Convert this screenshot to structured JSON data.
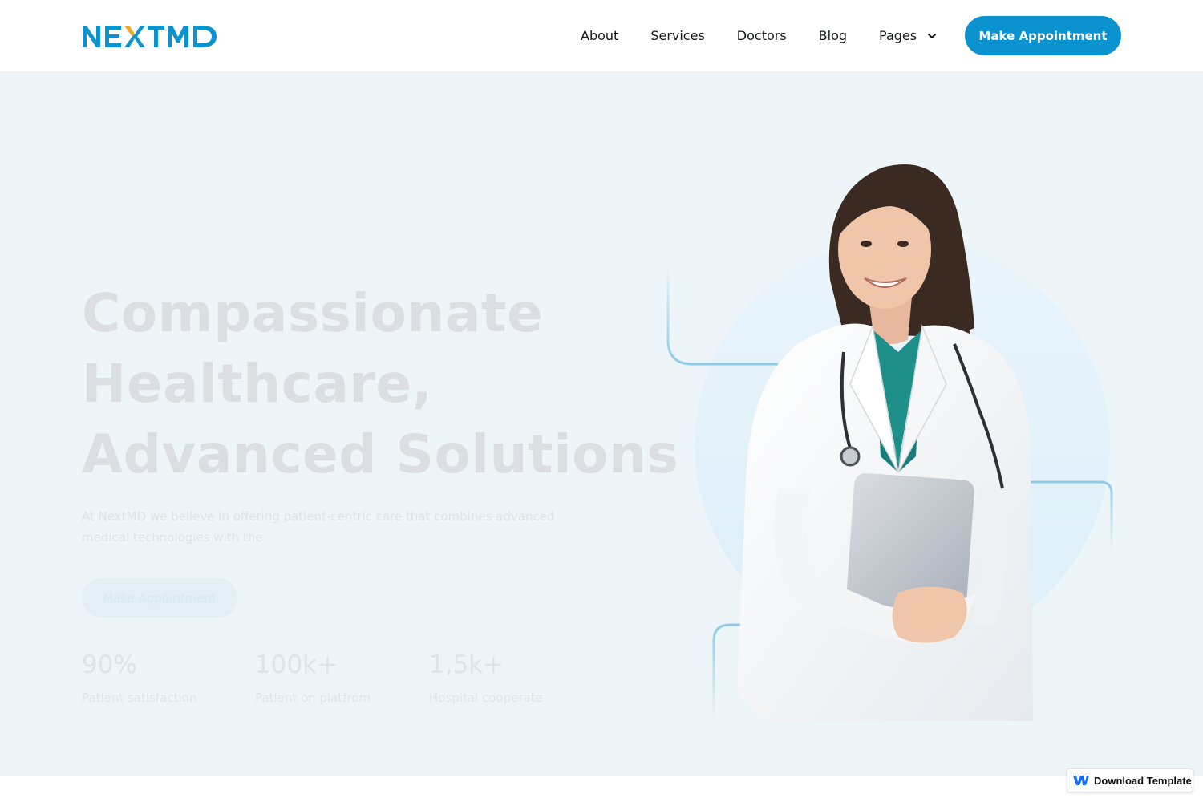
{
  "brand": {
    "logo_text": "NEXTMD",
    "colors": {
      "primary": "#0a93cf",
      "accent": "#f5a623",
      "hero_bg": "#edf5f9"
    }
  },
  "nav": {
    "links": [
      {
        "label": "About"
      },
      {
        "label": "Services"
      },
      {
        "label": "Doctors"
      },
      {
        "label": "Blog"
      },
      {
        "label": "Pages",
        "icon": "chevron-down-icon"
      }
    ],
    "cta_label": "Make Appointment"
  },
  "hero": {
    "title_lines": [
      "Compassionate",
      "Healthcare,",
      "Advanced Solutions"
    ],
    "description": "At NextMD we believe in offering patient-centric care that combines advanced medical technologies with the",
    "button_label": "Make Appointment",
    "stats": [
      {
        "value": "90%",
        "label": "Patient satisfaction"
      },
      {
        "value": "100k+",
        "label": "Patient on platfrom"
      },
      {
        "value": "1,5k+",
        "label": "Hospital cooperate"
      }
    ],
    "image": "doctor-photo"
  },
  "badge": {
    "label": "Download Template",
    "icon": "webflow-icon"
  }
}
